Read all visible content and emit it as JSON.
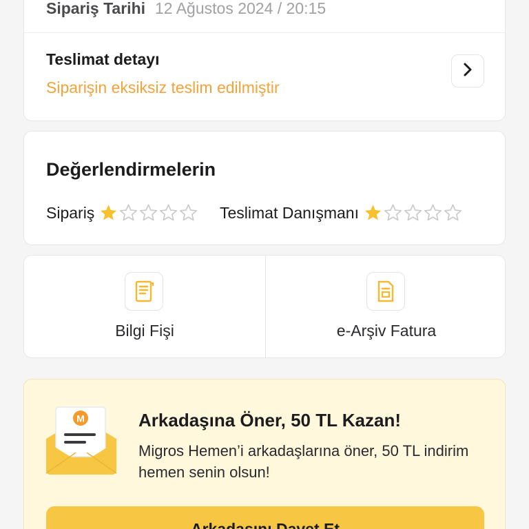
{
  "order": {
    "date_label": "Sipariş Tarihi",
    "date_value": "12 Ağustos 2024 / 20:15",
    "delivery_title": "Teslimat detayı",
    "delivery_status": "Siparişin eksiksiz teslim edilmiştir",
    "delivery_detail_icon": "chevron-right-icon"
  },
  "ratings": {
    "title": "Değerlendirmelerin",
    "order_label": "Sipariş",
    "order_rating": 1,
    "advisor_label": "Teslimat Danışmanı",
    "advisor_rating": 1,
    "max_rating": 5
  },
  "documents": {
    "receipt_label": "Bilgi Fişi",
    "receipt_icon": "receipt-icon",
    "invoice_label": "e-Arşiv Fatura",
    "invoice_icon": "invoice-icon"
  },
  "referral": {
    "badge_letter": "M",
    "title": "Arkadaşına Öner, 50 TL Kazan!",
    "description": "Migros Hemen’i arkadaşlarına öner, 50 TL indirim hemen senin olsun!",
    "button_label": "Arkadaşını Davet Et"
  },
  "colors": {
    "accent_yellow": "#f7c744",
    "status_orange": "#f2a33a",
    "star_filled": "#f5c12e",
    "star_empty": "#c9c9cc",
    "referral_bg": "#fff8dc"
  }
}
